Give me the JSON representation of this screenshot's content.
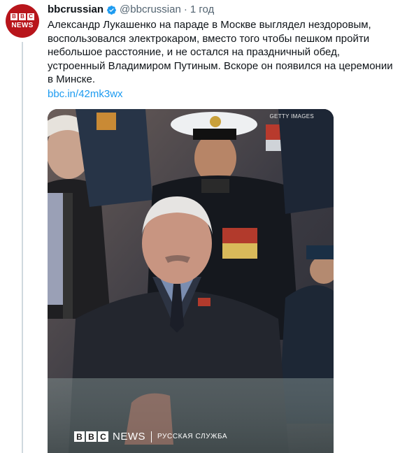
{
  "tweet": {
    "avatar": {
      "blocks": [
        "B",
        "B",
        "C"
      ],
      "label": "NEWS"
    },
    "display_name": "bbcrussian",
    "handle": "@bbcrussian",
    "separator": "·",
    "time": "1 год",
    "text": "Александр Лукашенко на параде в Москве выглядел нездоровым, воспользовался электрокаром, вместо того чтобы пешком пройти небольшое расстояние, и не остался на праздничный обед, устроенный Владимиром Путиным. Вскоре он появился на церемонии в Минске.",
    "link": "bbc.in/42mk3wx",
    "verified_color": "#1d9bf0"
  },
  "media": {
    "credit": "GETTY IMAGES",
    "watermark": {
      "blocks": [
        "B",
        "B",
        "C"
      ],
      "news": "NEWS",
      "service": "РУССКАЯ СЛУЖБА"
    }
  }
}
